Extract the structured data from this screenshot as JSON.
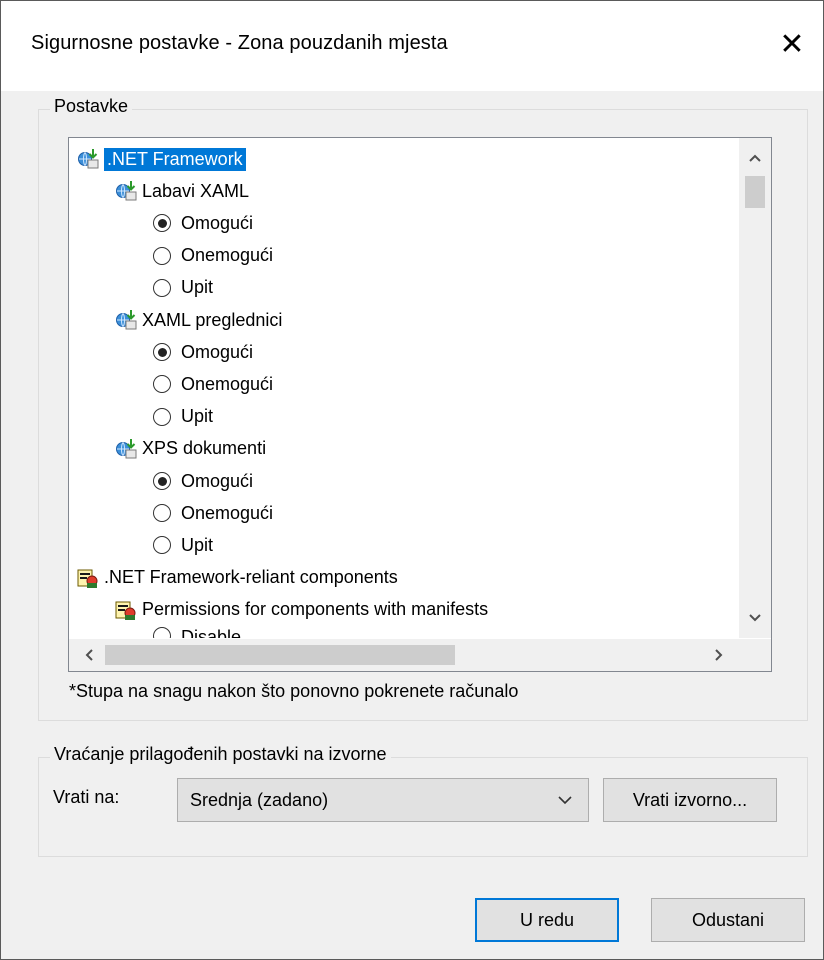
{
  "window": {
    "title": "Sigurnosne postavke - Zona pouzdanih mjesta",
    "close_glyph": "✕"
  },
  "settings_group": {
    "label": "Postavke",
    "tree": [
      {
        "kind": "category",
        "icon": "network-download-icon",
        "text": ".NET Framework",
        "selected": true
      },
      {
        "kind": "setting",
        "icon": "network-download-icon",
        "text": "Labavi XAML"
      },
      {
        "kind": "option",
        "text": "Omogući",
        "checked": true
      },
      {
        "kind": "option",
        "text": "Onemogući",
        "checked": false
      },
      {
        "kind": "option",
        "text": "Upit",
        "checked": false
      },
      {
        "kind": "setting",
        "icon": "network-download-icon",
        "text": "XAML preglednici"
      },
      {
        "kind": "option",
        "text": "Omogući",
        "checked": true
      },
      {
        "kind": "option",
        "text": "Onemogući",
        "checked": false
      },
      {
        "kind": "option",
        "text": "Upit",
        "checked": false
      },
      {
        "kind": "setting",
        "icon": "network-download-icon",
        "text": "XPS dokumenti"
      },
      {
        "kind": "option",
        "text": "Omogući",
        "checked": true
      },
      {
        "kind": "option",
        "text": "Onemogući",
        "checked": false
      },
      {
        "kind": "option",
        "text": "Upit",
        "checked": false
      },
      {
        "kind": "category",
        "icon": "certificate-components-icon",
        "text": ".NET Framework-reliant components"
      },
      {
        "kind": "setting",
        "icon": "certificate-components-icon",
        "text": "Permissions for components with manifests"
      },
      {
        "kind": "option",
        "text": "Disable",
        "checked": false
      }
    ],
    "note": "*Stupa na snagu nakon što ponovno pokrenete računalo"
  },
  "reset_group": {
    "label": "Vraćanje prilagođenih postavki na izvorne",
    "reset_to_label": "Vrati na:",
    "selected_level": "Srednja (zadano)",
    "reset_button": "Vrati izvorno..."
  },
  "footer": {
    "ok_button": "U redu",
    "cancel_button": "Odustani"
  },
  "colors": {
    "selection": "#0078d7",
    "window_bg": "#f0f0f0"
  }
}
